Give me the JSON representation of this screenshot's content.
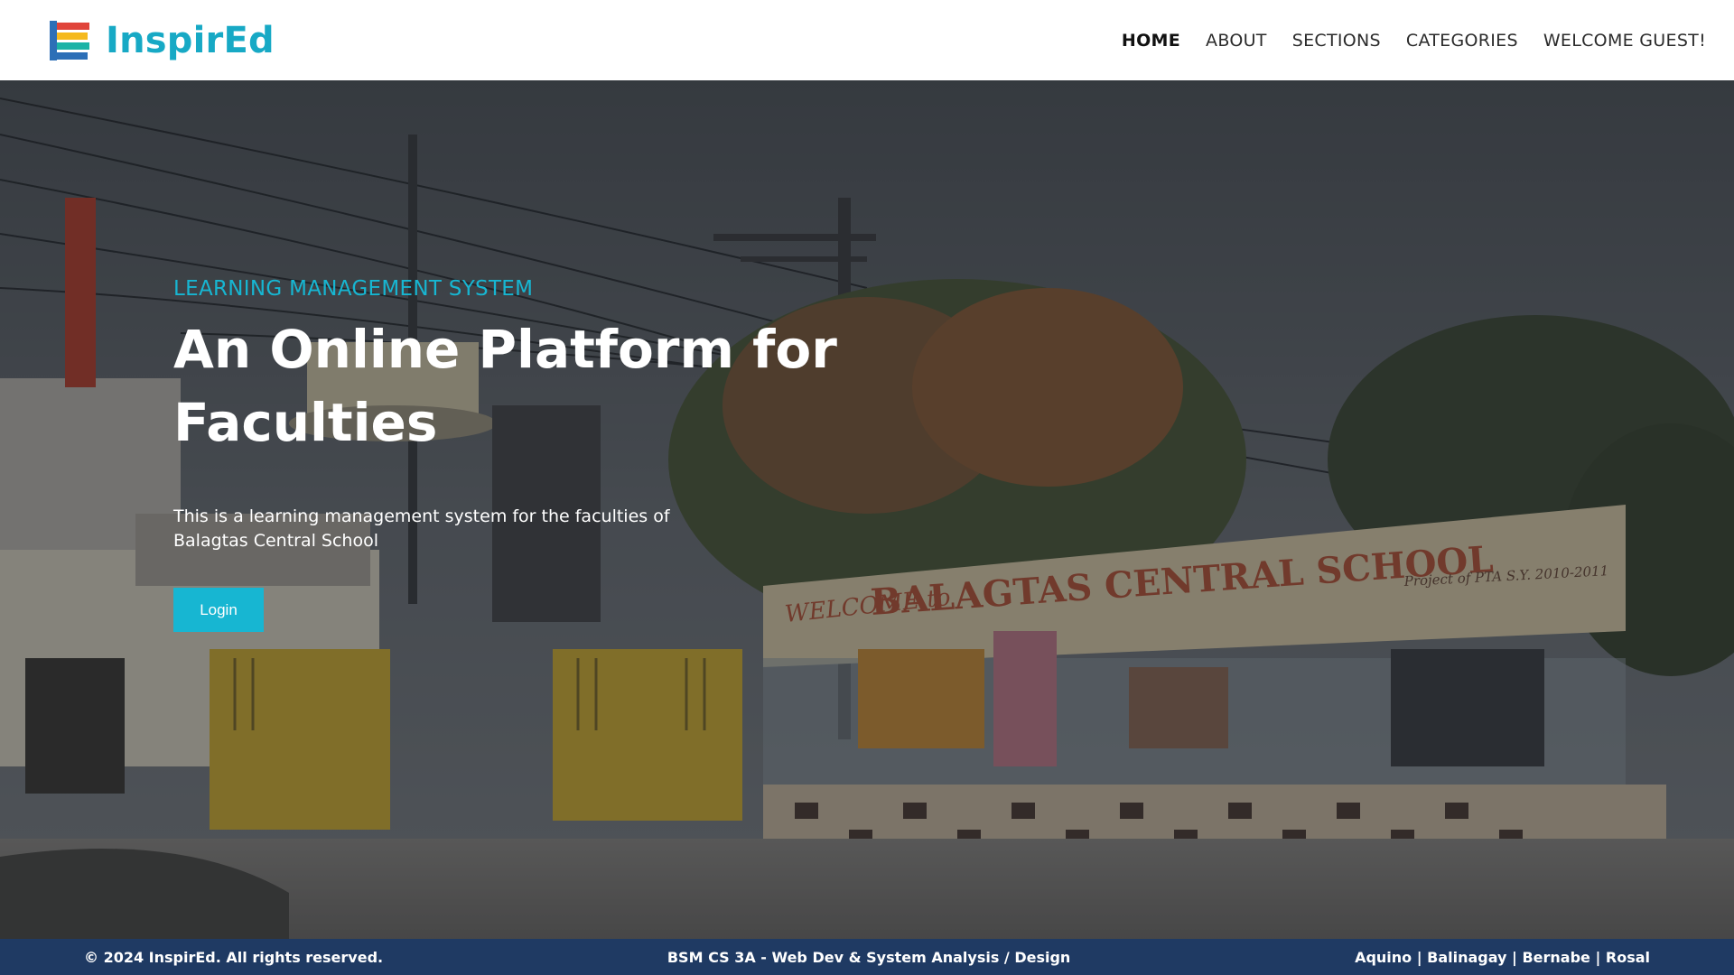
{
  "brand": {
    "name": "InspirEd",
    "logo_icon": "stacked-books-icon",
    "colors": {
      "accent": "#17a9c5",
      "book_red": "#e0443a",
      "book_yellow": "#f5b91e",
      "book_blue": "#2c6fb7",
      "book_teal": "#1bb3a6"
    }
  },
  "nav": {
    "items": [
      {
        "label": "HOME",
        "active": true
      },
      {
        "label": "ABOUT"
      },
      {
        "label": "SECTIONS"
      },
      {
        "label": "CATEGORIES"
      },
      {
        "label": "WELCOME GUEST!"
      }
    ]
  },
  "hero": {
    "background": "school-entrance-photo",
    "eyebrow": "LEARNING MANAGEMENT SYSTEM",
    "headline_line1": "An Online Platform for",
    "headline_line2": "Faculties",
    "lead": "This is a learning management system for the faculties of Balagtas Central School",
    "login_label": "Login",
    "sign_line1": "WELCOME to",
    "sign_line2": "BALAGTAS CENTRAL SCHOOL",
    "sign_line3": "Project of PTA S.Y. 2010-2011",
    "colors": {
      "accent": "#17b6d2"
    }
  },
  "footer": {
    "copyright": "© 2024 InspirEd. All rights reserved.",
    "course": "BSM CS 3A - Web Dev & System Analysis / Design",
    "authors": "Aquino | Balinagay | Bernabe | Rosal",
    "colors": {
      "background": "#1f3a63"
    }
  }
}
